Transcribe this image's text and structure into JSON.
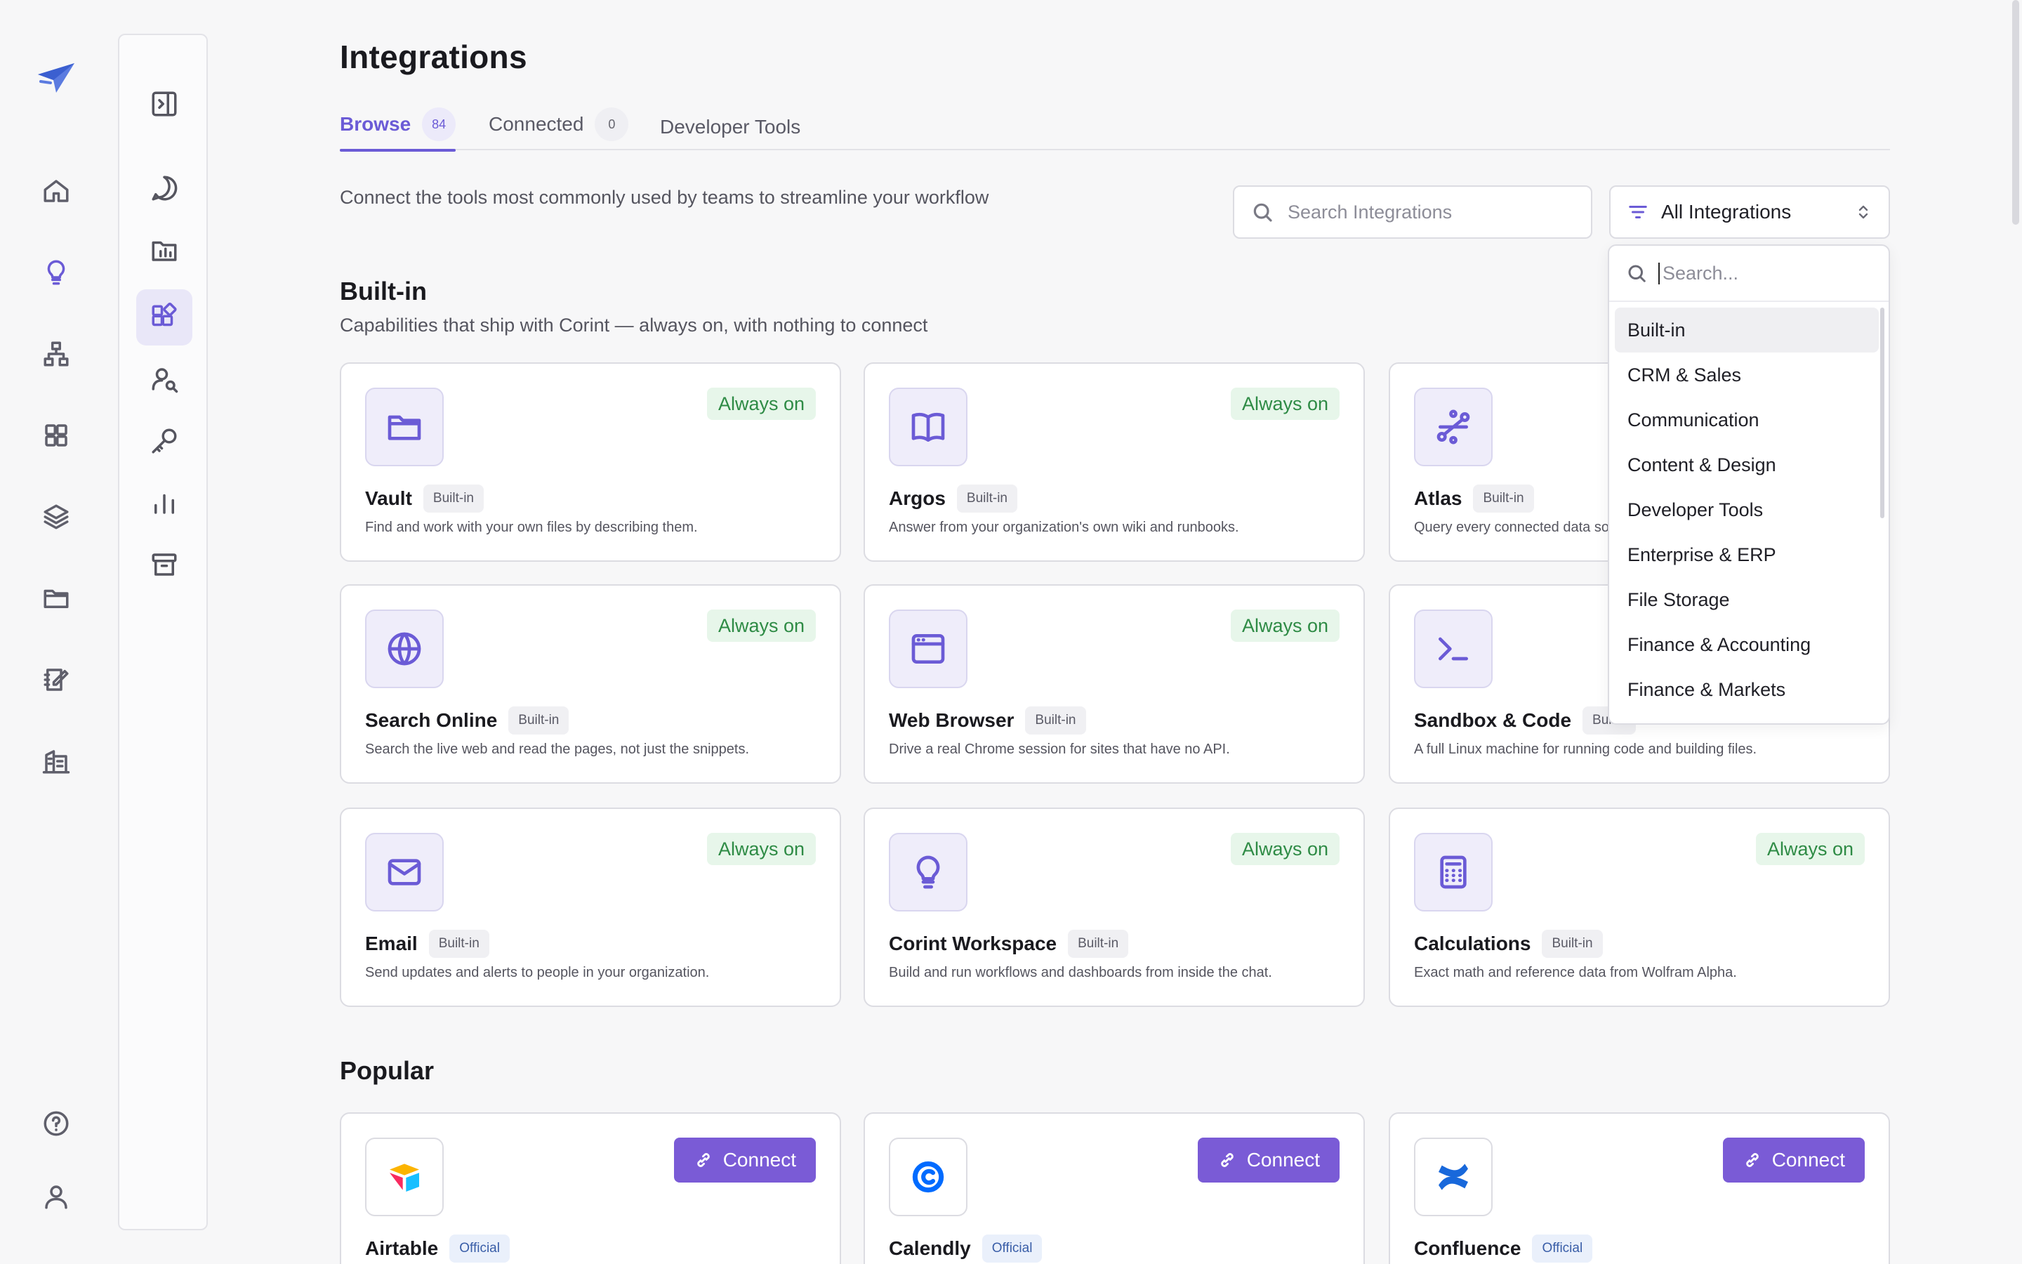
{
  "page": {
    "title": "Integrations",
    "description": "Connect the tools most commonly used by teams to streamline your workflow"
  },
  "tabs": [
    {
      "label": "Browse",
      "count": "84",
      "active": true
    },
    {
      "label": "Connected",
      "count": "0",
      "active": false
    },
    {
      "label": "Developer Tools",
      "active": false
    }
  ],
  "search": {
    "placeholder": "Search Integrations"
  },
  "filter": {
    "label": "All Integrations"
  },
  "dropdown": {
    "placeholder": "Search...",
    "options": [
      "Built-in",
      "CRM & Sales",
      "Communication",
      "Content & Design",
      "Developer Tools",
      "Enterprise & ERP",
      "File Storage",
      "Finance & Accounting",
      "Finance & Markets"
    ],
    "selected": "Built-in"
  },
  "builtin": {
    "title": "Built-in",
    "subtitle": "Capabilities that ship with Corint — always on, with nothing to connect",
    "status": "Always on",
    "tag": "Built-in",
    "cards": [
      {
        "name": "Vault",
        "icon": "folder-icon",
        "desc": "Find and work with your own files by describing them."
      },
      {
        "name": "Argos",
        "icon": "book-open-icon",
        "desc": "Answer from your organization's own wiki and runbooks."
      },
      {
        "name": "Atlas",
        "icon": "graph-route-icon",
        "desc": "Query every connected data so"
      },
      {
        "name": "Search Online",
        "icon": "globe-icon",
        "desc": "Search the live web and read the pages, not just the snippets."
      },
      {
        "name": "Web Browser",
        "icon": "browser-window-icon",
        "desc": "Drive a real Chrome session for sites that have no API."
      },
      {
        "name": "Sandbox & Code",
        "icon": "terminal-icon",
        "desc": "A full Linux machine for running code and building files."
      },
      {
        "name": "Email",
        "icon": "mail-icon",
        "desc": "Send updates and alerts to people in your organization."
      },
      {
        "name": "Corint Workspace",
        "icon": "lightbulb-icon",
        "desc": "Build and run workflows and dashboards from inside the chat."
      },
      {
        "name": "Calculations",
        "icon": "calculator-icon",
        "desc": "Exact math and reference data from Wolfram Alpha."
      }
    ],
    "partial_tags": {
      "atlas": "Built-in",
      "sandbox": "Built-i"
    }
  },
  "popular": {
    "title": "Popular",
    "connect_label": "Connect",
    "tag": "Official",
    "cards": [
      {
        "name": "Airtable",
        "icon": "airtable-logo-icon"
      },
      {
        "name": "Calendly",
        "icon": "calendly-logo-icon"
      },
      {
        "name": "Confluence",
        "icon": "confluence-logo-icon"
      }
    ]
  },
  "colors": {
    "accent": "#6b5bd6",
    "connect_button": "#7a5bd6",
    "always_on_bg": "#e7f6ea",
    "always_on_text": "#2e8b45"
  }
}
